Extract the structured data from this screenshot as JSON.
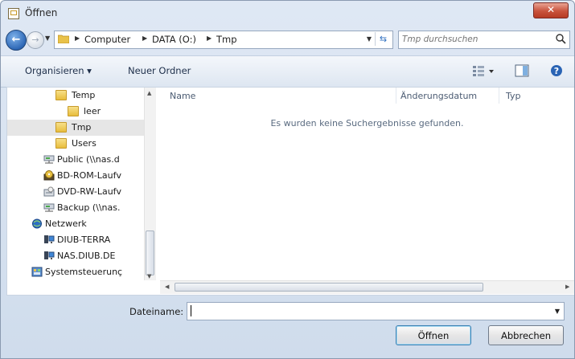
{
  "window": {
    "title": "Öffnen",
    "close_label": "✕"
  },
  "nav": {
    "back_glyph": "←",
    "forward_glyph": "→",
    "breadcrumbs": [
      "Computer",
      "DATA (O:)",
      "Tmp"
    ],
    "search_placeholder": "Tmp durchsuchen"
  },
  "toolbar": {
    "organize_label": "Organisieren ▾",
    "new_folder_label": "Neuer Ordner"
  },
  "sidebar": {
    "items": [
      {
        "label": "Temp",
        "icon": "folder-icon"
      },
      {
        "label": "leer",
        "icon": "folder-icon"
      },
      {
        "label": "Tmp",
        "icon": "folder-icon",
        "selected": true
      },
      {
        "label": "Users",
        "icon": "folder-icon"
      },
      {
        "label": "Public (\\\\nas.d",
        "icon": "network-drive-icon"
      },
      {
        "label": "BD-ROM-Laufv",
        "icon": "bd-rom-icon"
      },
      {
        "label": "DVD-RW-Laufv",
        "icon": "dvd-drive-icon"
      },
      {
        "label": "Backup (\\\\nas.",
        "icon": "network-drive-icon"
      },
      {
        "label": "Netzwerk",
        "icon": "network-icon"
      },
      {
        "label": "DIUB-TERRA",
        "icon": "computer-icon"
      },
      {
        "label": "NAS.DIUB.DE",
        "icon": "computer-icon"
      },
      {
        "label": "Systemsteuerunç",
        "icon": "control-panel-icon"
      }
    ]
  },
  "file_list": {
    "columns": [
      "Name",
      "Änderungsdatum",
      "Typ"
    ],
    "empty_message": "Es wurden keine Suchergebnisse gefunden."
  },
  "footer": {
    "filename_label": "Dateiname:",
    "filename_value": "",
    "open_label": "Öffnen",
    "cancel_label": "Abbrechen"
  }
}
